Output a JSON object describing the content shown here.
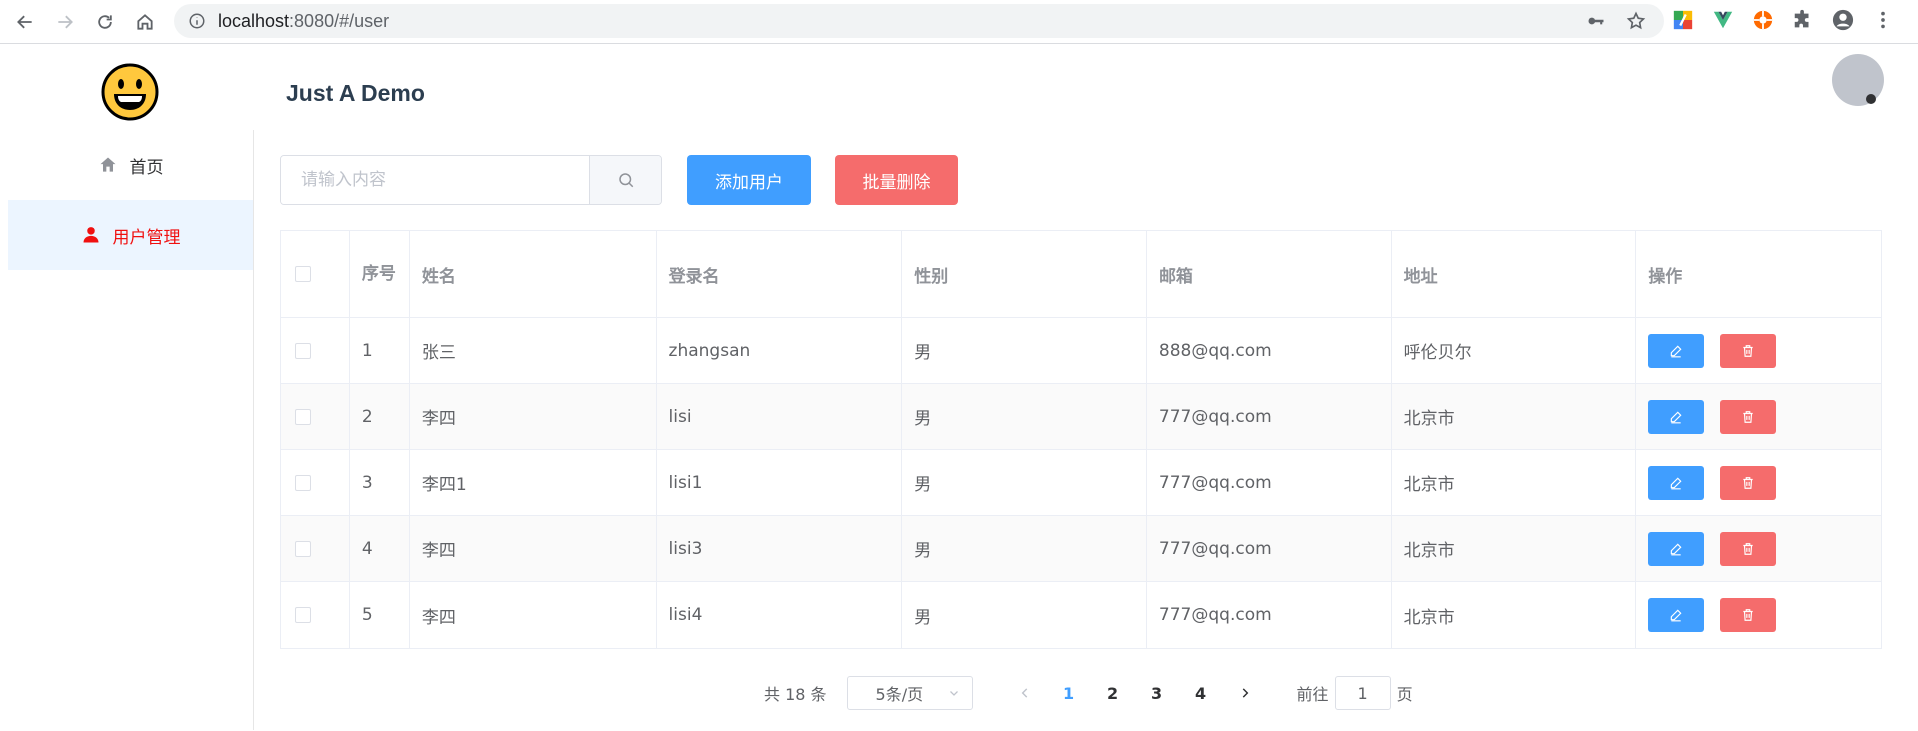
{
  "browser": {
    "url_host": "localhost",
    "url_rest": ":8080/#/user"
  },
  "sidebar": {
    "items": [
      {
        "label": "首页",
        "icon": "home-icon",
        "active": false
      },
      {
        "label": "用户管理",
        "icon": "user-icon",
        "active": true
      }
    ]
  },
  "header": {
    "title": "Just A Demo"
  },
  "toolbar": {
    "search_placeholder": "请输入内容",
    "add_label": "添加用户",
    "batch_delete_label": "批量删除"
  },
  "table": {
    "columns": [
      "序号",
      "姓名",
      "登录名",
      "性别",
      "邮箱",
      "地址",
      "操作"
    ],
    "rows": [
      {
        "no": "1",
        "name": "张三",
        "login": "zhangsan",
        "gender": "男",
        "email": "888@qq.com",
        "address": "呼伦贝尔"
      },
      {
        "no": "2",
        "name": "李四",
        "login": "lisi",
        "gender": "男",
        "email": "777@qq.com",
        "address": "北京市"
      },
      {
        "no": "3",
        "name": "李四1",
        "login": "lisi1",
        "gender": "男",
        "email": "777@qq.com",
        "address": "北京市"
      },
      {
        "no": "4",
        "name": "李四",
        "login": "lisi3",
        "gender": "男",
        "email": "777@qq.com",
        "address": "北京市"
      },
      {
        "no": "5",
        "name": "李四",
        "login": "lisi4",
        "gender": "男",
        "email": "777@qq.com",
        "address": "北京市"
      }
    ]
  },
  "pagination": {
    "total_text": "共 18 条",
    "page_size": "5条/页",
    "pages": [
      "1",
      "2",
      "3",
      "4"
    ],
    "current_page": "1",
    "goto_prefix": "前往",
    "goto_value": "1",
    "goto_suffix": "页"
  },
  "colors": {
    "primary": "#409eff",
    "danger": "#f56c6c",
    "active_menu_text": "#f01010",
    "active_menu_bg": "#ecf5ff"
  }
}
